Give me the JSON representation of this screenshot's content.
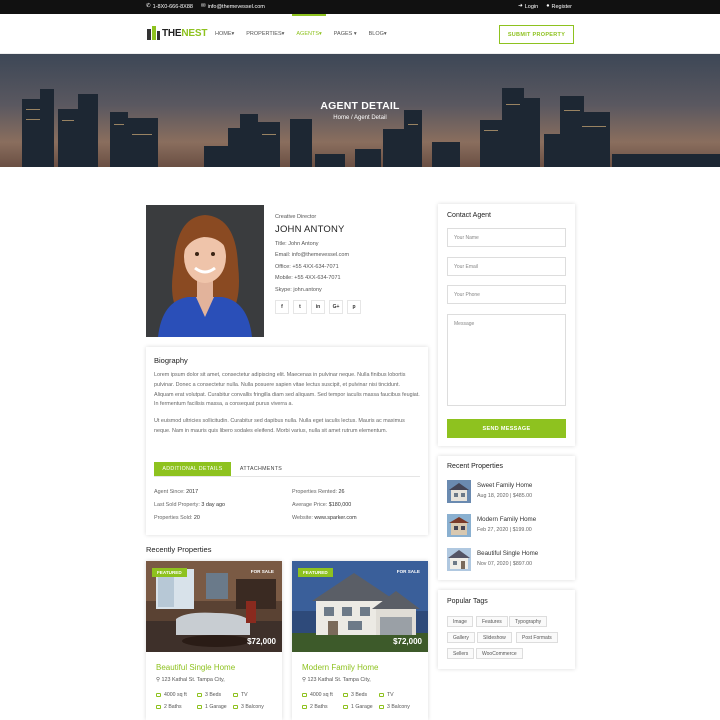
{
  "topbar": {
    "phone": "1-8X0-666-8X88",
    "email": "info@themevessel.com",
    "login": "Login",
    "register": "Register"
  },
  "brand": {
    "name_part1": "THE",
    "name_part2": "NEST",
    "accent_color": "#8ec21f"
  },
  "nav": {
    "items": [
      "HOME",
      "PROPERTIES",
      "AGENTS",
      "PAGES",
      "BLOG"
    ],
    "active": "AGENTS",
    "submit_label": "SUBMIT PROPERTY"
  },
  "banner": {
    "title": "AGENT DETAIL",
    "crumb_home": "Home",
    "crumb_sep": "/",
    "crumb_current": "Agent Detail"
  },
  "agent": {
    "role": "Creative Director",
    "name": "JOHN ANTONY",
    "title_label": "Title:",
    "title_value": "John Antony",
    "email_label": "Email:",
    "email_value": "info@themevessel.com",
    "office_label": "Office:",
    "office_value": "+55 4XX-634-7071",
    "mobile_label": "Mobile:",
    "mobile_value": "+55 4XX-634-7071",
    "skype_label": "Skype:",
    "skype_value": "john.antony",
    "socials": [
      "f",
      "t",
      "in",
      "G+",
      "p"
    ]
  },
  "biography": {
    "title": "Biography",
    "p1": "Lorem ipsum dolor sit amet, consectetur adipiscing elit. Maecenas in pulvinar neque. Nulla finibus lobortis pulvinar. Donec a consectetur nulla. Nulla posuere sapien vitae lectus suscipit, et pulvinar nisi tincidunt. Aliquam erat volutpat. Curabitur convallis fringilla diam sed aliquam. Sed tempor iaculis massa faucibus feugiat. In fermentum facilisis massa, a consequat purus viverra a.",
    "p2": "Ut euismod ultricies sollicitudin. Curabitur sed dapibus nulla. Nulla eget iaculis lectus. Mauris ac maximus neque. Nam in mauris quis libero sodales eleifend. Morbi varius, nulla sit amet rutrum elementum."
  },
  "tabs": {
    "active": "ADDITIONAL DETAILS",
    "other": "ATTACHMENTS"
  },
  "details": {
    "agent_since_label": "Agent Since:",
    "agent_since": "2017",
    "last_sold_label": "Last Sold Property:",
    "last_sold": "3 day ago",
    "props_sold_label": "Properties Sold:",
    "props_sold": "20",
    "rented_label": "Properties Rented:",
    "rented": "26",
    "avg_price_label": "Average Price:",
    "avg_price": "$180,000",
    "website_label": "Website:",
    "website": "www.sparker.com"
  },
  "recently_properties": {
    "title": "Recently Properties",
    "items": [
      {
        "featured": "FEATURED",
        "status": "FOR SALE",
        "price": "$72,000",
        "name": "Beautiful Single Home",
        "address": "123 Kathal St. Tampa City,",
        "sqft": "4000 sq ft",
        "beds": "3 Beds",
        "tv": "TV",
        "baths": "2 Baths",
        "garage": "1 Garage",
        "balcony": "3 Balcony"
      },
      {
        "featured": "FEATURED",
        "status": "FOR SALE",
        "price": "$72,000",
        "name": "Modern Family Home",
        "address": "123 Kathal St. Tampa City,",
        "sqft": "4000 sq ft",
        "beds": "3 Beds",
        "tv": "TV",
        "baths": "2 Baths",
        "garage": "1 Garage",
        "balcony": "3 Balcony"
      }
    ]
  },
  "contact": {
    "title": "Contact Agent",
    "name_placeholder": "Your Name",
    "email_placeholder": "Your Email",
    "phone_placeholder": "Your Phone",
    "message_placeholder": "Message",
    "send_label": "SEND MESSAGE"
  },
  "recent_properties": {
    "title": "Recent Properties",
    "items": [
      {
        "name": "Sweet Family Home",
        "date": "Aug 18, 2020",
        "sep": "|",
        "price": "$485.00"
      },
      {
        "name": "Modern Family Home",
        "date": "Feb 27, 2020",
        "sep": "|",
        "price": "$199.00"
      },
      {
        "name": "Beautiful Single Home",
        "date": "Nov 07, 2020",
        "sep": "|",
        "price": "$897.00"
      }
    ]
  },
  "popular_tags": {
    "title": "Popular Tags",
    "items": [
      "Image",
      "Features",
      "Typography",
      "Gallery",
      "Slideshow",
      "Post Formats",
      "Sellers",
      "WooCommerce"
    ]
  }
}
